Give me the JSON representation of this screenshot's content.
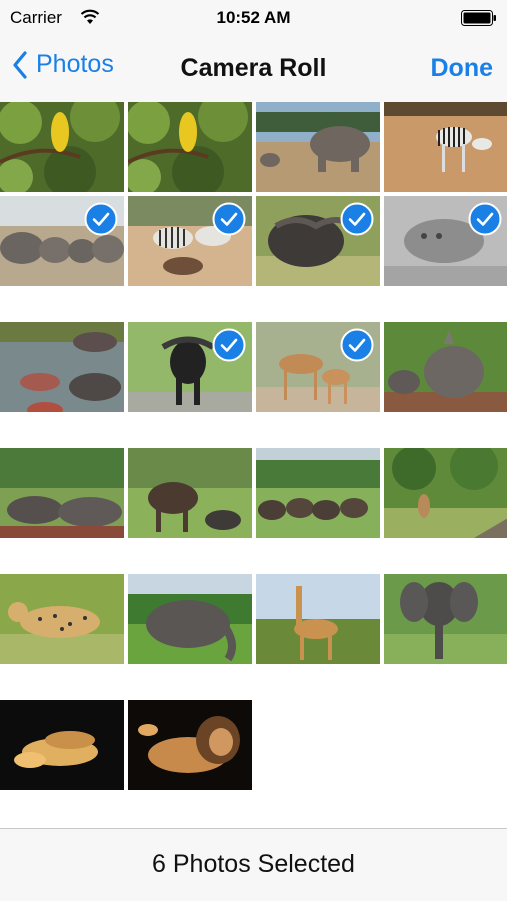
{
  "status_bar": {
    "carrier": "Carrier",
    "time": "10:52 AM"
  },
  "nav": {
    "back_label": "Photos",
    "title": "Camera Roll",
    "done_label": "Done"
  },
  "footer": {
    "selection_text": "6 Photos Selected"
  },
  "colors": {
    "accent": "#1a80e6",
    "bar_background": "#f7f7f7"
  },
  "photos": [
    {
      "subject": "pear tree",
      "selected": false
    },
    {
      "subject": "pear tree",
      "selected": false
    },
    {
      "subject": "elephant",
      "selected": false
    },
    {
      "subject": "zebras",
      "selected": false
    },
    {
      "subject": "elephant herd",
      "selected": true
    },
    {
      "subject": "zebras and warthog",
      "selected": true
    },
    {
      "subject": "buffalo",
      "selected": true
    },
    {
      "subject": "hippo",
      "selected": true
    },
    {
      "subject": "hippos in water",
      "selected": false
    },
    {
      "subject": "buffalo",
      "selected": true
    },
    {
      "subject": "nyala antelope",
      "selected": true
    },
    {
      "subject": "rhino",
      "selected": false
    },
    {
      "subject": "rhinos resting",
      "selected": false
    },
    {
      "subject": "wildebeest",
      "selected": false
    },
    {
      "subject": "buffalo herd",
      "selected": false
    },
    {
      "subject": "antelope in bush",
      "selected": false
    },
    {
      "subject": "cheetah",
      "selected": false
    },
    {
      "subject": "elephant",
      "selected": false
    },
    {
      "subject": "giraffe",
      "selected": false
    },
    {
      "subject": "elephant",
      "selected": false
    },
    {
      "subject": "lions at night",
      "selected": false
    },
    {
      "subject": "lion at night",
      "selected": false
    }
  ]
}
